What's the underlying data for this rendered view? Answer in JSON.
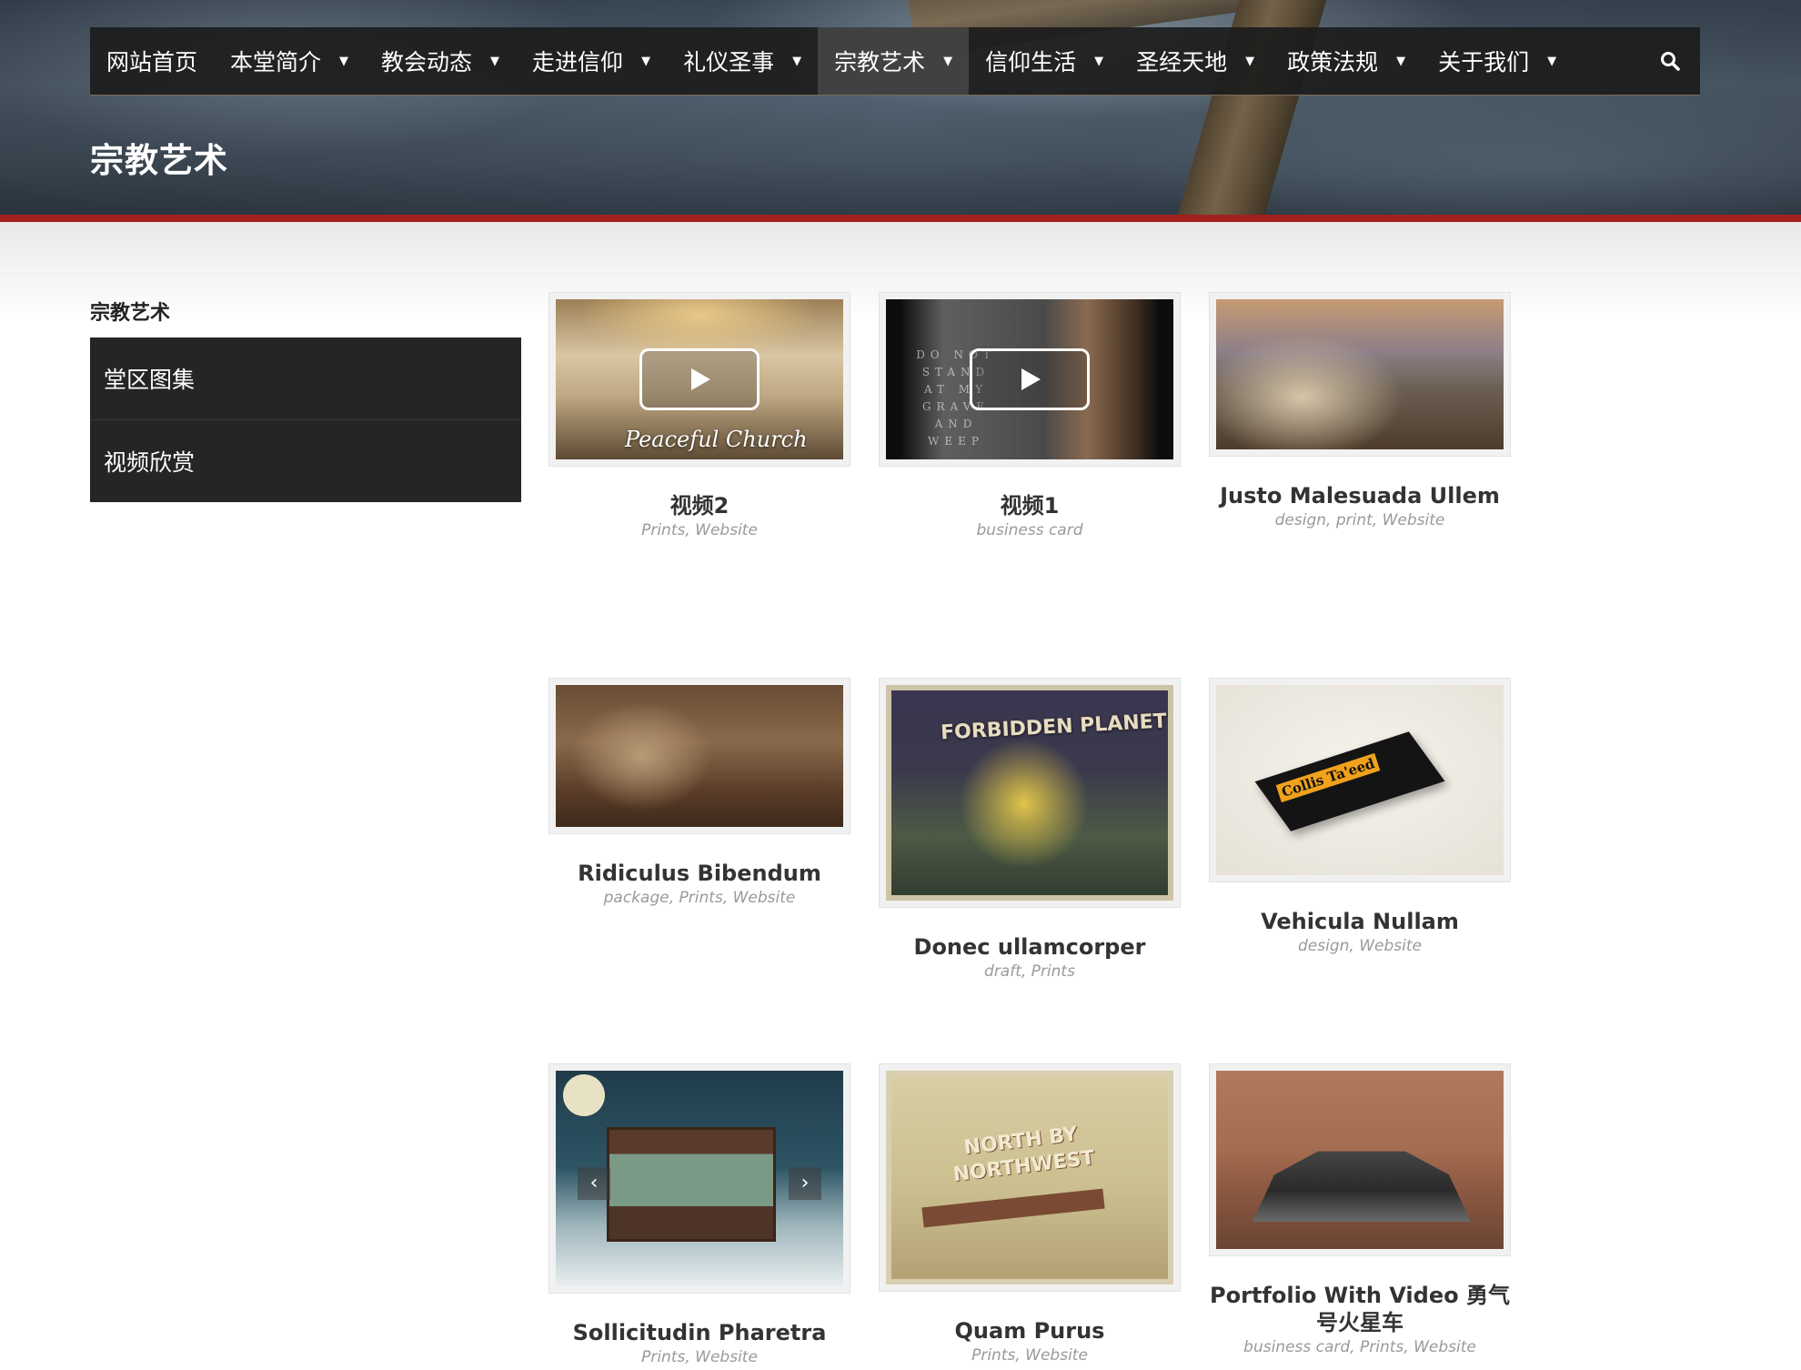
{
  "nav": {
    "items": [
      {
        "label": "网站首页",
        "has_caret": false
      },
      {
        "label": "本堂简介",
        "has_caret": true
      },
      {
        "label": "教会动态",
        "has_caret": true
      },
      {
        "label": "走进信仰",
        "has_caret": true
      },
      {
        "label": "礼仪圣事",
        "has_caret": true
      },
      {
        "label": "宗教艺术",
        "has_caret": true,
        "active": true
      },
      {
        "label": "信仰生活",
        "has_caret": true
      },
      {
        "label": "圣经天地",
        "has_caret": true
      },
      {
        "label": "政策法规",
        "has_caret": true
      },
      {
        "label": "关于我们",
        "has_caret": true
      }
    ],
    "caret_glyph": "▼",
    "search_icon": "search-icon"
  },
  "page": {
    "title": "宗教艺术"
  },
  "sidebar": {
    "title": "宗教艺术",
    "items": [
      {
        "label": "堂区图集"
      },
      {
        "label": "视频欣赏"
      }
    ]
  },
  "portfolio": [
    {
      "title": "视频2",
      "categories": "Prints, Website",
      "is_video": true,
      "overlay_text": "Peaceful Church"
    },
    {
      "title": "视频1",
      "categories": "business card",
      "is_video": true,
      "overlay_text": "DO NOT STAND AT MY GRAVE AND WEEP"
    },
    {
      "title": "Justo Malesuada Ullem",
      "categories": "design, print, Website"
    },
    {
      "title": "Ridiculus Bibendum",
      "categories": "package, Prints, Website"
    },
    {
      "title": "Donec ullamcorper",
      "categories": "draft, Prints",
      "overlay_text": "FORBIDDEN PLANET"
    },
    {
      "title": "Vehicula Nullam",
      "categories": "design, Website",
      "overlay_text": "Collis Ta'eed"
    },
    {
      "title": "Sollicitudin Pharetra",
      "categories": "Prints, Website"
    },
    {
      "title": "Quam Purus",
      "categories": "Prints, Website",
      "overlay_text": "NORTH BY NORTHWEST"
    },
    {
      "title": "Portfolio With Video 勇气号火星车",
      "categories": "business card, Prints, Website"
    }
  ],
  "colors": {
    "accent": "#a3211f",
    "nav_bg": "#1c1c1c",
    "sidebar_bg": "#252525",
    "title_text": "#333333",
    "category_text": "#9a9a9a"
  }
}
